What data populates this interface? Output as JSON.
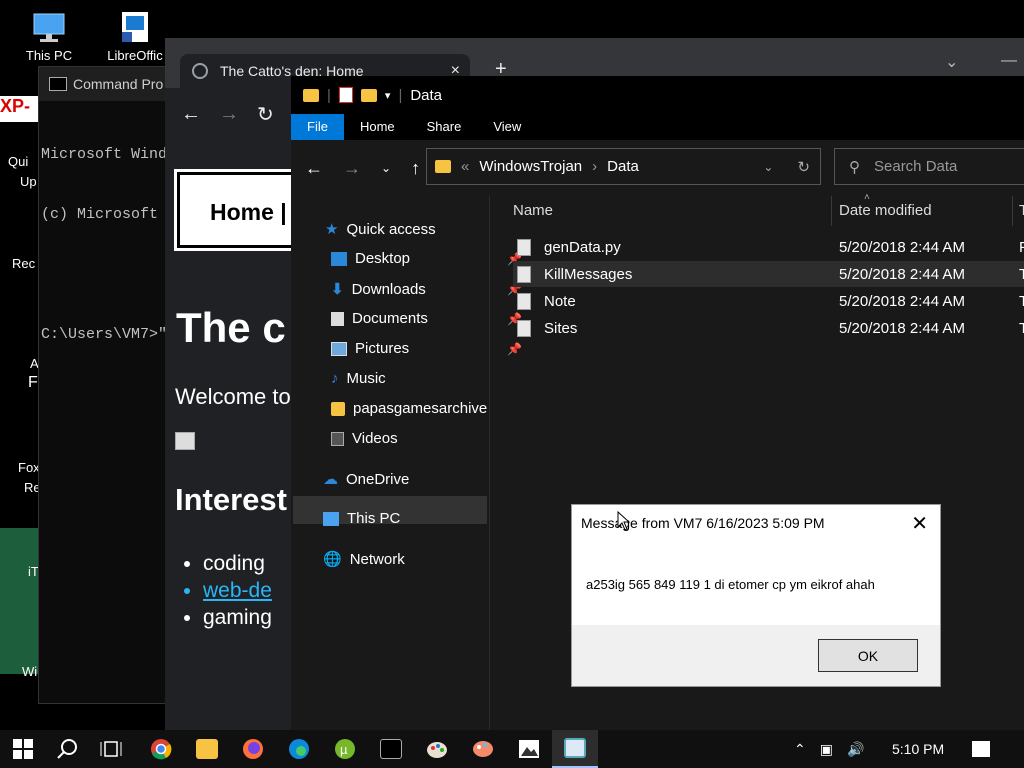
{
  "desktop": {
    "icons": [
      {
        "label": "This PC"
      },
      {
        "label": "LibreOffic"
      }
    ],
    "partial_labels": [
      "XP-",
      "Qui",
      "Up",
      "Rec",
      "A",
      "F",
      "Fox",
      "Re",
      "iT",
      "Wi"
    ]
  },
  "cmd": {
    "title": "Command Pro",
    "lines": [
      "Microsoft Wind",
      "(c) Microsoft",
      "",
      "C:\\Users\\VM7>\""
    ]
  },
  "browser": {
    "tab_title": "The Catto's den: Home",
    "tab_close": "×",
    "new_tab": "+",
    "page": {
      "nav_home": "Home |",
      "heading": "The c",
      "welcome": "Welcome to",
      "section": "Interest",
      "list": [
        "coding",
        "web-de",
        "gaming"
      ]
    }
  },
  "explorer": {
    "title": "Data",
    "ribbon": [
      "File",
      "Home",
      "Share",
      "View"
    ],
    "breadcrumb": [
      "WindowsTrojan",
      "Data"
    ],
    "search_placeholder": "Search Data",
    "nav": {
      "quick_access": "Quick access",
      "items": [
        "Desktop",
        "Downloads",
        "Documents",
        "Pictures",
        "Music",
        "papasgamesarchive",
        "Videos"
      ],
      "onedrive": "OneDrive",
      "this_pc": "This PC",
      "network": "Network"
    },
    "columns": {
      "name": "Name",
      "date": "Date modified",
      "type": "T"
    },
    "files": [
      {
        "name": "genData.py",
        "date": "5/20/2018 2:44 AM",
        "type": "P"
      },
      {
        "name": "KillMessages",
        "date": "5/20/2018 2:44 AM",
        "type": "T"
      },
      {
        "name": "Note",
        "date": "5/20/2018 2:44 AM",
        "type": "T"
      },
      {
        "name": "Sites",
        "date": "5/20/2018 2:44 AM",
        "type": "T"
      }
    ]
  },
  "dialog": {
    "title": "Message from VM7 6/16/2023 5:09 PM",
    "message": "a253ig 565 849 119 1 di etomer cp ym eikrof ahah",
    "ok": "OK"
  },
  "taskbar": {
    "time": "5:10 PM"
  },
  "colors": {
    "accent": "#0078d7",
    "folder": "#f6c343",
    "link": "#29b6f6"
  }
}
